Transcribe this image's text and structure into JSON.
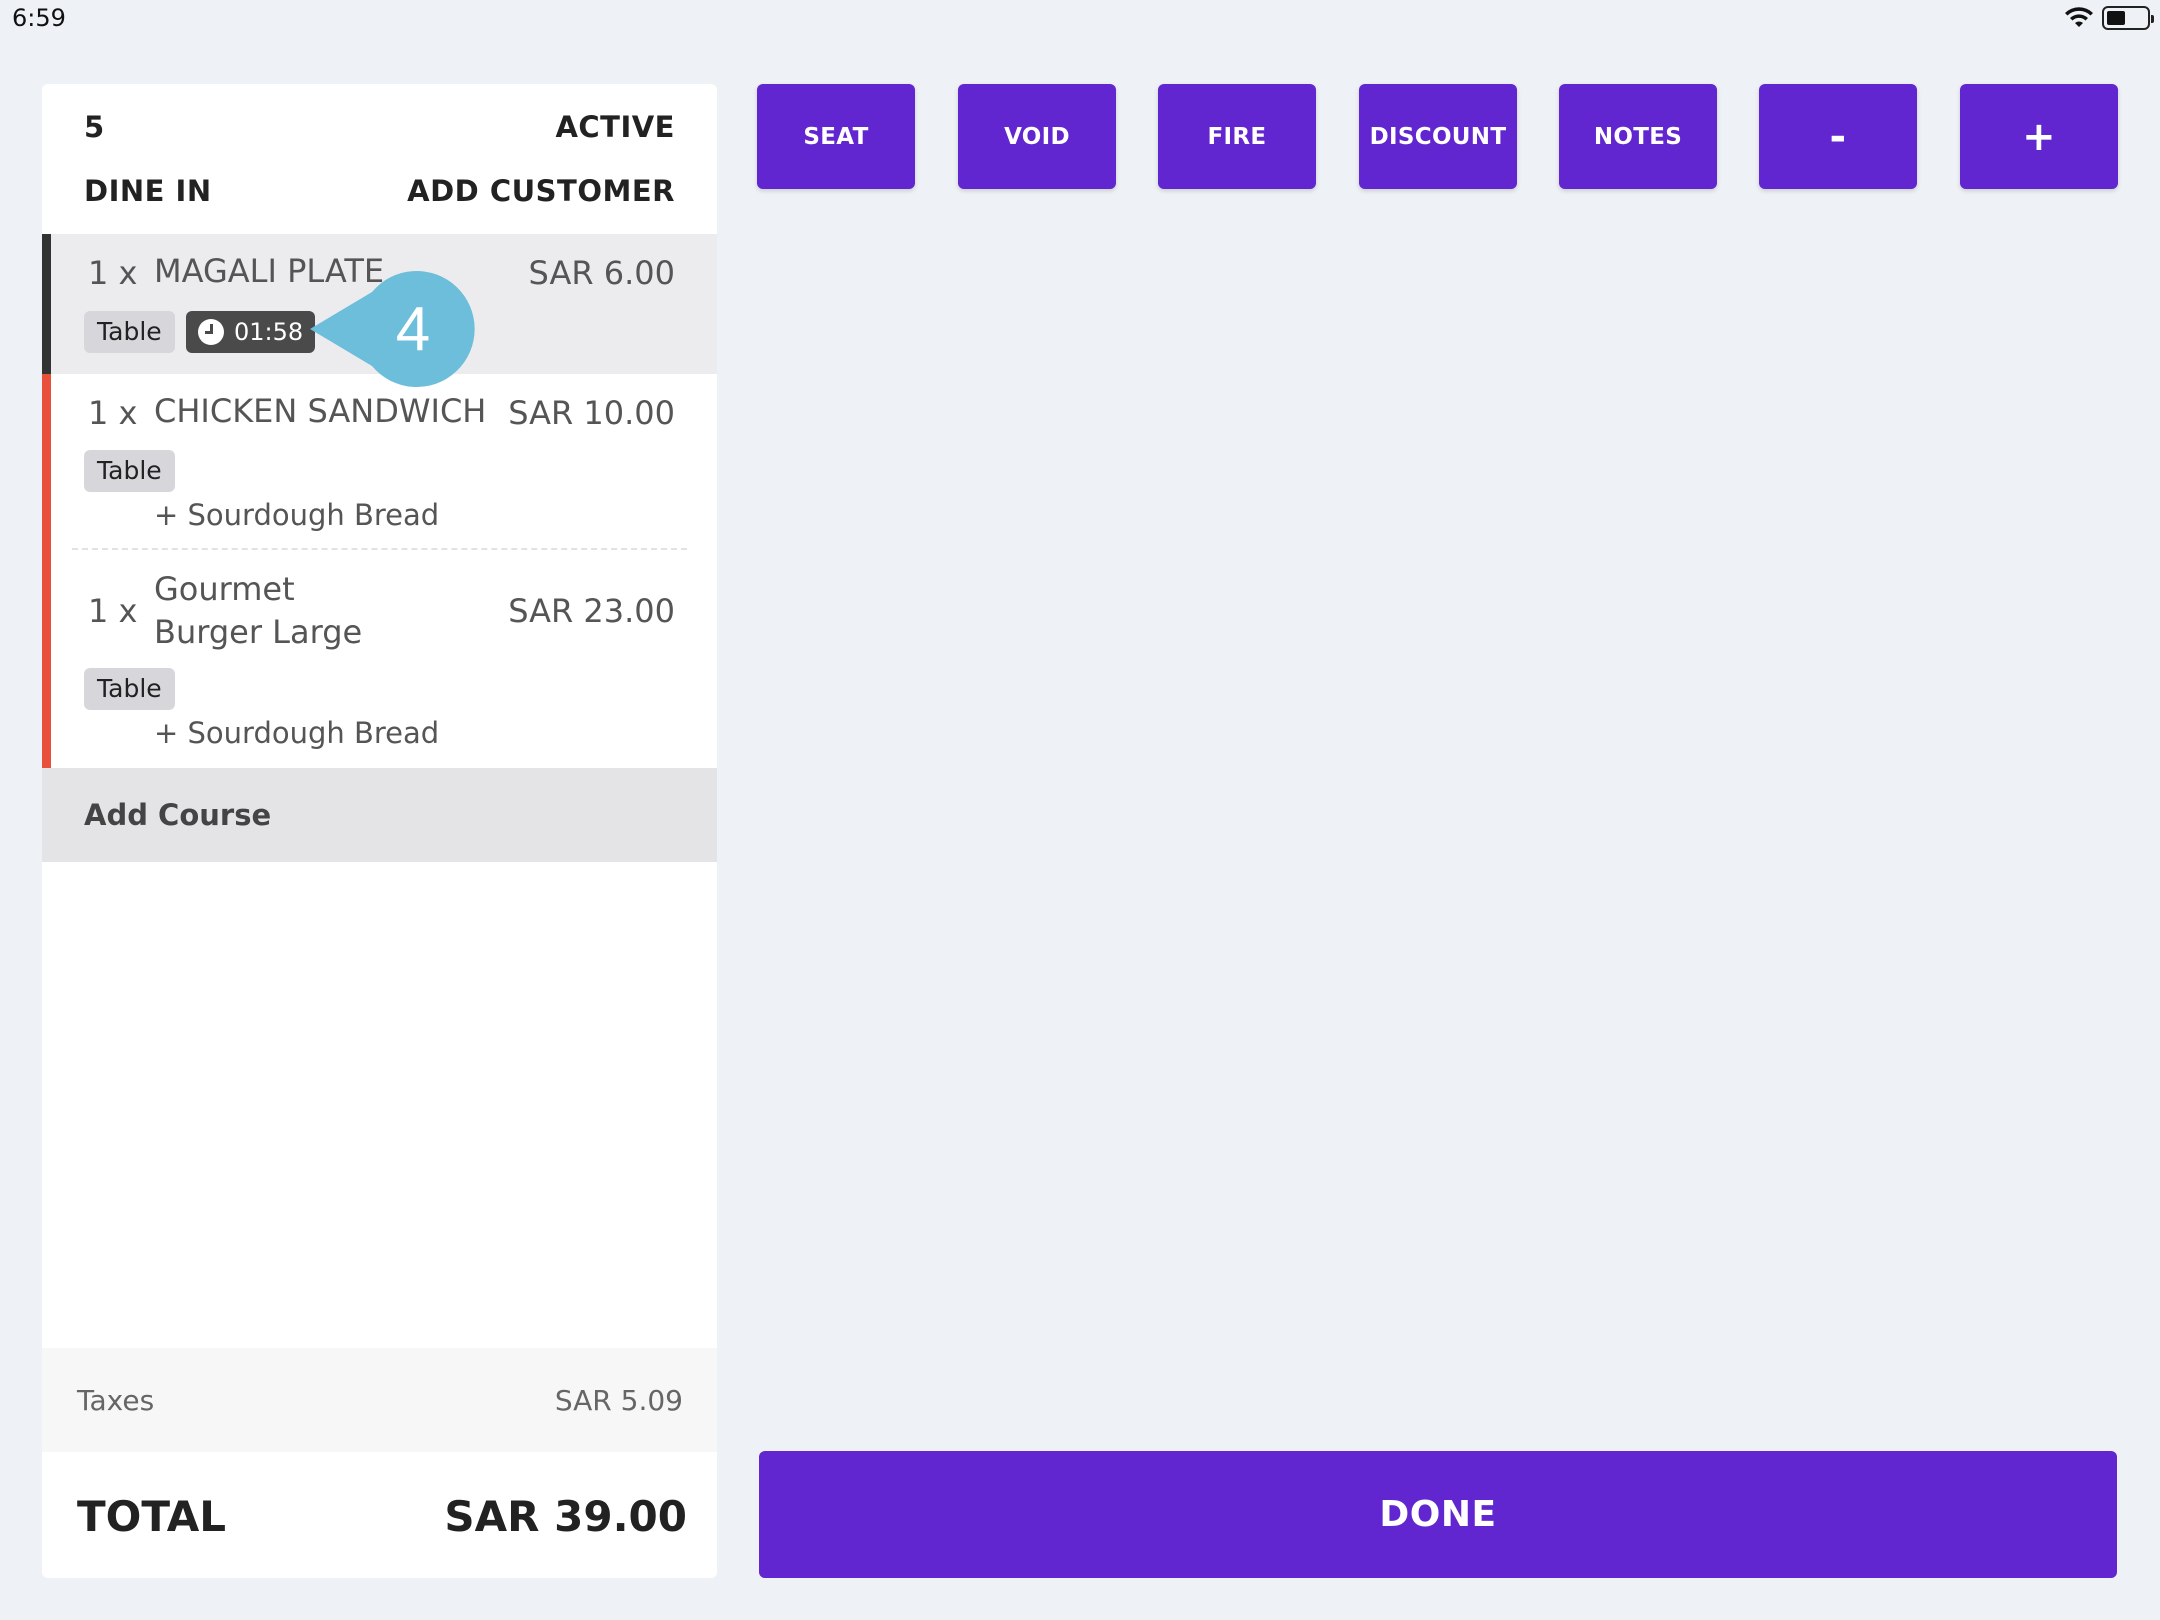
{
  "status_bar": {
    "time": "6:59"
  },
  "order": {
    "number": "5",
    "state": "ACTIVE",
    "type": "DINE IN",
    "add_customer": "ADD CUSTOMER",
    "items": [
      {
        "qty": "1",
        "x": "x",
        "name": "MAGALI PLATE",
        "price": "SAR 6.00",
        "tag": "Table",
        "timer": "01:58"
      },
      {
        "qty": "1",
        "x": "x",
        "name": "CHICKEN SANDWICH",
        "price": "SAR 10.00",
        "tag": "Table",
        "modifier": "+ Sourdough Bread"
      },
      {
        "qty": "1",
        "x": "x",
        "name_line1": "Gourmet",
        "name_line2": "Burger Large",
        "price": "SAR 23.00",
        "tag": "Table",
        "modifier": "+ Sourdough Bread"
      }
    ],
    "add_course": "Add Course",
    "taxes_label": "Taxes",
    "taxes_value": "SAR 5.09",
    "total_label": "TOTAL",
    "total_value": "SAR 39.00"
  },
  "callout": {
    "number": "4"
  },
  "actions": {
    "seat": "SEAT",
    "void": "VOID",
    "fire": "FIRE",
    "discount": "DISCOUNT",
    "notes": "NOTES",
    "minus": "-",
    "plus": "+"
  },
  "done": "DONE",
  "colors": {
    "accent": "#6126cf",
    "item_bar_selected": "#333333",
    "item_bar_pending": "#e9503c",
    "callout": "#6dbedb"
  }
}
